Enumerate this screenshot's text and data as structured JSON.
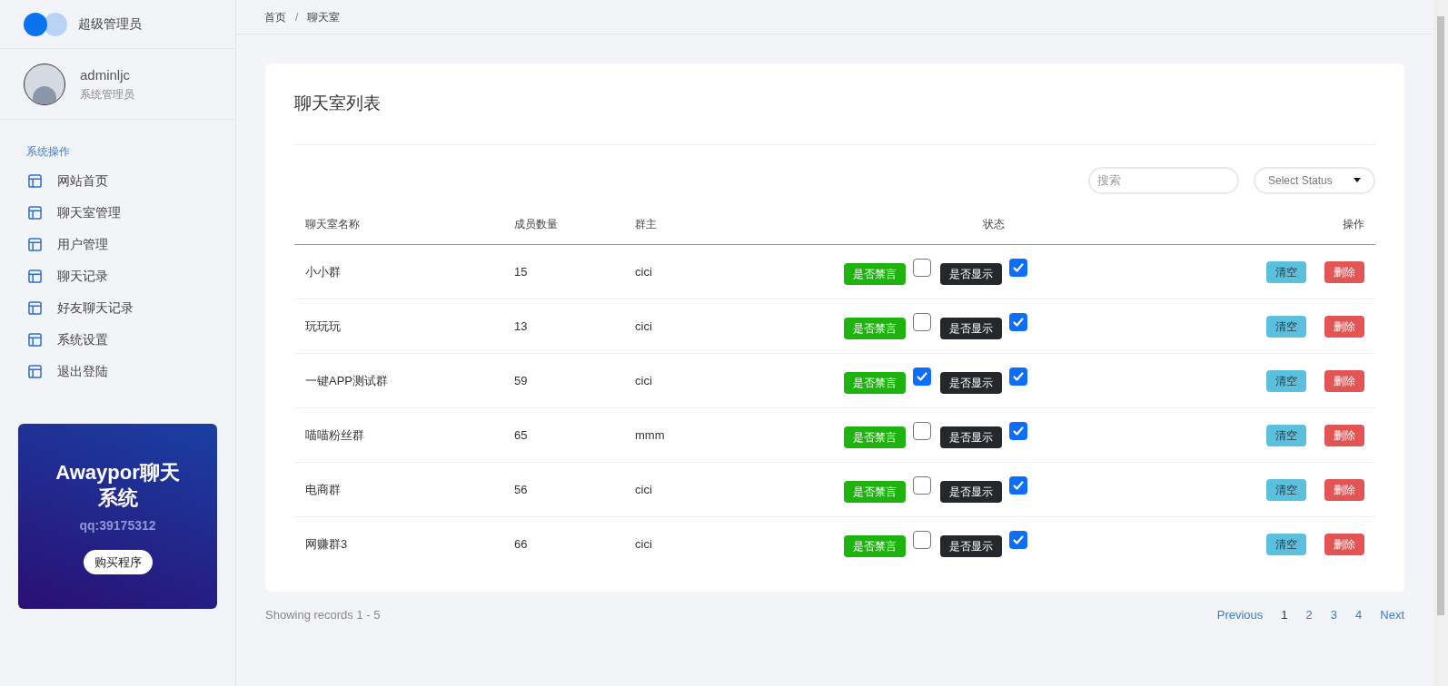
{
  "brand": {
    "title": "超级管理员"
  },
  "user": {
    "name": "adminljc",
    "role": "系统管理员"
  },
  "sidebar": {
    "section": "系统操作",
    "items": [
      {
        "label": "网站首页"
      },
      {
        "label": "聊天室管理"
      },
      {
        "label": "用户管理"
      },
      {
        "label": "聊天记录"
      },
      {
        "label": "好友聊天记录"
      },
      {
        "label": "系统设置"
      },
      {
        "label": "退出登陆"
      }
    ]
  },
  "promo": {
    "title": "Awaypor聊天系统",
    "subtitle": "qq:39175312",
    "button": "购买程序"
  },
  "breadcrumb": {
    "separator": "/",
    "items": [
      "首页",
      "聊天室"
    ]
  },
  "card": {
    "title": "聊天室列表",
    "search": {
      "placeholder": "搜索"
    },
    "status_select": {
      "placeholder": "Select Status"
    }
  },
  "table": {
    "columns": [
      "聊天室名称",
      "成员数量",
      "群主",
      "状态",
      "操作"
    ],
    "rows": [
      {
        "name": "小小群",
        "members": "15",
        "owner": "cici",
        "mute_label": "是否禁言",
        "muted": false,
        "show_label": "是否显示",
        "shown": true,
        "clear": "清空",
        "delete": "删除"
      },
      {
        "name": "玩玩玩",
        "members": "13",
        "owner": "cici",
        "mute_label": "是否禁言",
        "muted": false,
        "show_label": "是否显示",
        "shown": true,
        "clear": "清空",
        "delete": "删除"
      },
      {
        "name": "一键APP测试群",
        "members": "59",
        "owner": "cici",
        "mute_label": "是否禁言",
        "muted": true,
        "show_label": "是否显示",
        "shown": true,
        "clear": "清空",
        "delete": "删除"
      },
      {
        "name": "喵喵粉丝群",
        "members": "65",
        "owner": "mmm",
        "mute_label": "是否禁言",
        "muted": false,
        "show_label": "是否显示",
        "shown": true,
        "clear": "清空",
        "delete": "删除"
      },
      {
        "name": "电商群",
        "members": "56",
        "owner": "cici",
        "mute_label": "是否禁言",
        "muted": false,
        "show_label": "是否显示",
        "shown": true,
        "clear": "清空",
        "delete": "删除"
      },
      {
        "name": "网赚群3",
        "members": "66",
        "owner": "cici",
        "mute_label": "是否禁言",
        "muted": false,
        "show_label": "是否显示",
        "shown": true,
        "clear": "清空",
        "delete": "删除"
      }
    ]
  },
  "footer": {
    "records": "Showing records 1 - 5",
    "pagination": [
      {
        "label": "Previous",
        "selected": false
      },
      {
        "label": "1",
        "selected": true
      },
      {
        "label": "2",
        "selected": false
      },
      {
        "label": "3",
        "selected": false
      },
      {
        "label": "4",
        "selected": false
      },
      {
        "label": "Next",
        "selected": false
      }
    ]
  }
}
